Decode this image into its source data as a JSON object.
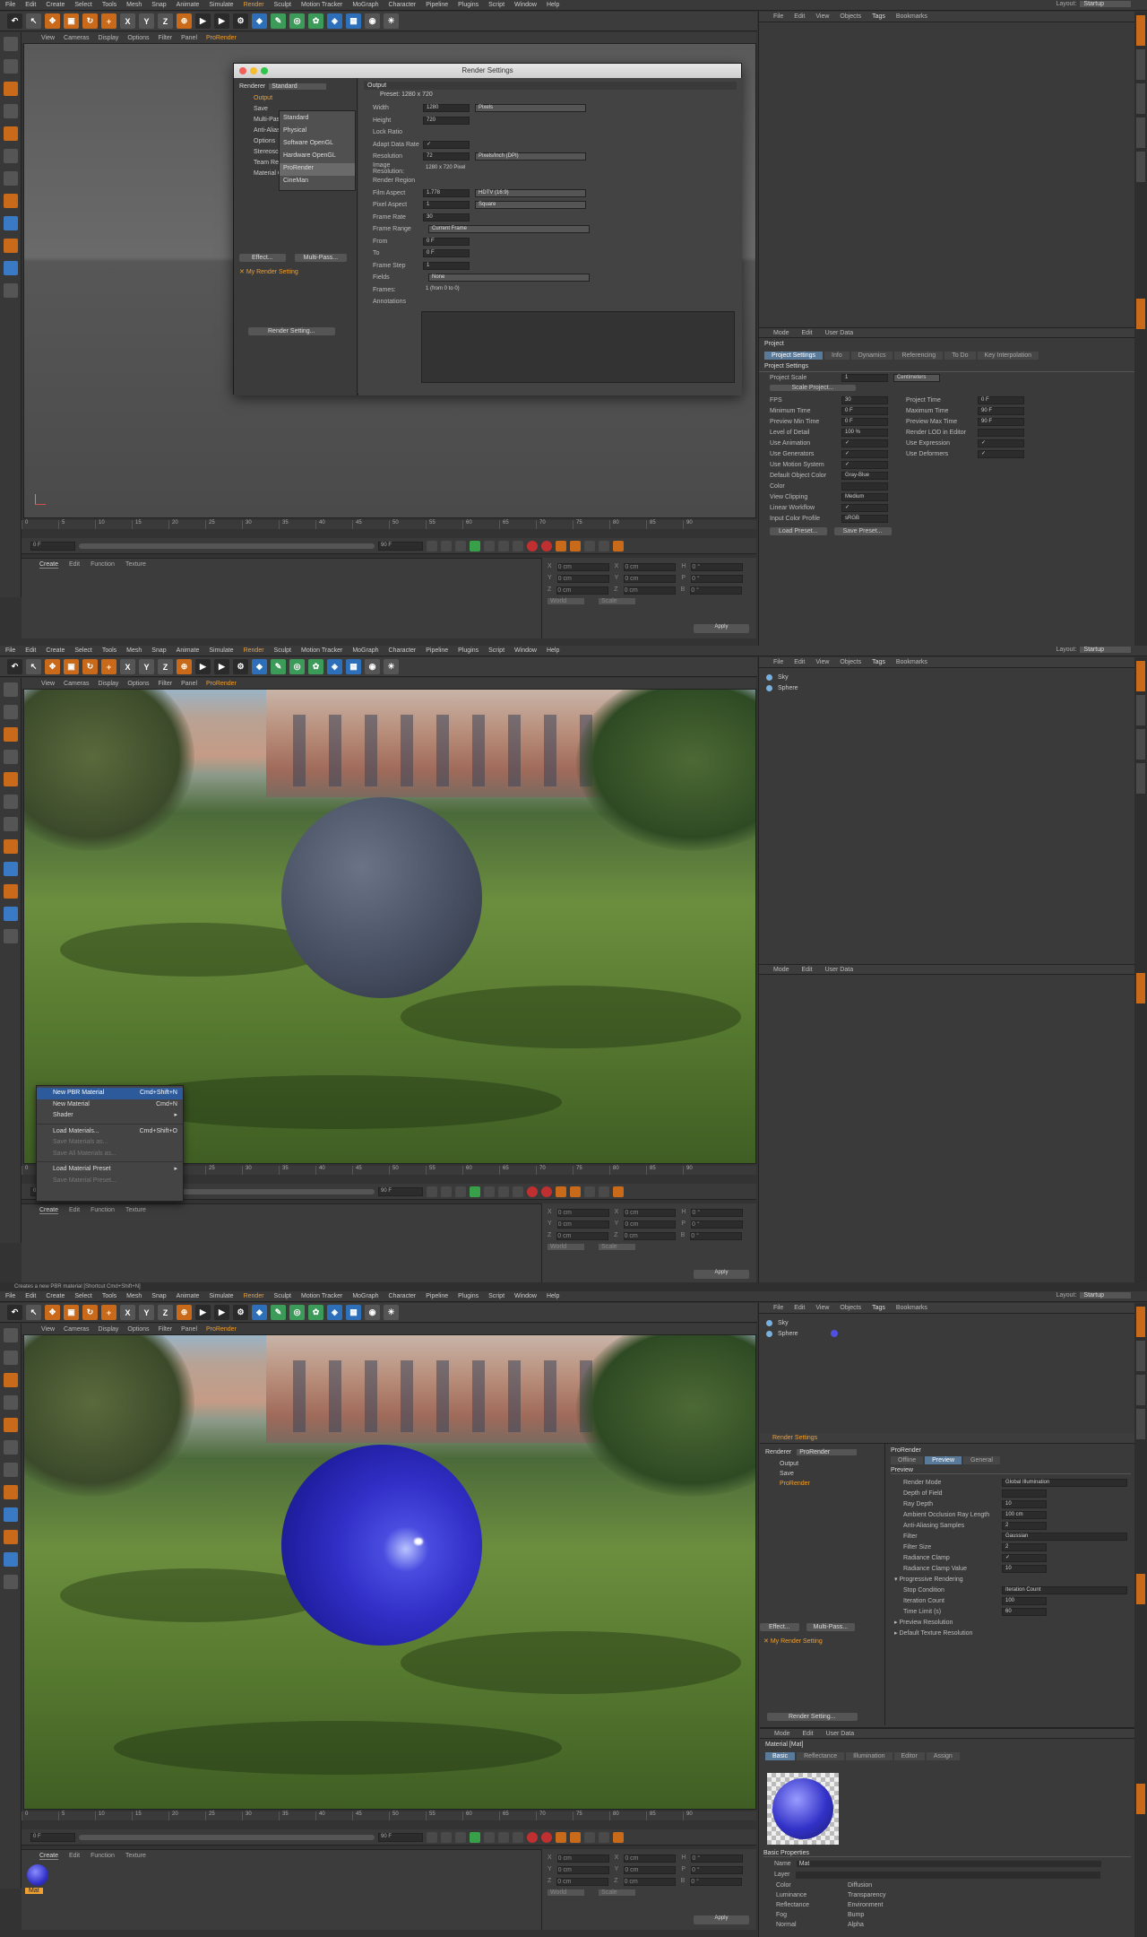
{
  "menu": [
    "File",
    "Edit",
    "Create",
    "Select",
    "Tools",
    "Mesh",
    "Snap",
    "Animate",
    "Simulate",
    "Render",
    "Sculpt",
    "Motion Tracker",
    "MoGraph",
    "Character",
    "Pipeline",
    "Plugins",
    "Script",
    "Window",
    "Help"
  ],
  "layout": {
    "label": "Layout:",
    "value": "Startup"
  },
  "viewport_menu": [
    "View",
    "Cameras",
    "Display",
    "Options",
    "Filter",
    "Panel",
    "ProRender"
  ],
  "timeline_ticks": [
    "0",
    "5",
    "10",
    "15",
    "20",
    "25",
    "30",
    "35",
    "40",
    "45",
    "50",
    "55",
    "60",
    "65",
    "70",
    "75",
    "80",
    "85",
    "90"
  ],
  "transport": {
    "start": "0 F",
    "end": "90 F",
    "current": "0 F"
  },
  "material_menu": [
    "Create",
    "Edit",
    "Function",
    "Texture"
  ],
  "coords": {
    "x": "X",
    "y": "Y",
    "z": "Z",
    "h": "H",
    "p": "P",
    "b": "B",
    "pos": "0 cm",
    "rot": "0 °",
    "world": "World",
    "scale": "Scale",
    "apply": "Apply"
  },
  "objman_menu": [
    "File",
    "Edit",
    "View",
    "Objects",
    "Tags",
    "Bookmarks"
  ],
  "attr_menu": [
    "Mode",
    "Edit",
    "User Data"
  ],
  "objects": [
    "Sky",
    "Sphere"
  ],
  "panel1": {
    "render_settings": {
      "title": "Render Settings",
      "renderer_label": "Renderer",
      "renderer_value": "Standard",
      "renderer_options": [
        "Standard",
        "Physical",
        "Software OpenGL",
        "Hardware OpenGL",
        "ProRender",
        "CineMan"
      ],
      "left_items": [
        "Output",
        "Save",
        "Multi-Pass",
        "Anti-Aliasing",
        "Options",
        "Stereoscopic",
        "Team Render",
        "Material Override"
      ],
      "effect_btn": "Effect...",
      "multipass_btn": "Multi-Pass...",
      "my_setting": "My Render Setting",
      "render_setting_btn": "Render Setting...",
      "section": "Output",
      "preset": "Preset: 1280 x 720",
      "rows": [
        {
          "l": "Width",
          "v": "1280",
          "d": "Pixels"
        },
        {
          "l": "Height",
          "v": "720",
          "d": ""
        },
        {
          "l": "Lock Ratio",
          "v": "",
          "d": ""
        },
        {
          "l": "Adapt Data Rate",
          "v": "✓",
          "d": ""
        },
        {
          "l": "Resolution",
          "v": "72",
          "d": "Pixels/Inch (DPI)"
        },
        {
          "l": "Image Resolution:",
          "v": "1280 x 720 Pixel",
          "d": ""
        },
        {
          "l": "Render Region",
          "v": "",
          "d": ""
        },
        {
          "l": "Film Aspect",
          "v": "1.778",
          "d": "HDTV (16:9)"
        },
        {
          "l": "Pixel Aspect",
          "v": "1",
          "d": "Square"
        },
        {
          "l": "Frame Rate",
          "v": "30",
          "d": ""
        },
        {
          "l": "Frame Range",
          "v": "",
          "d": "Current Frame"
        },
        {
          "l": "From",
          "v": "0 F",
          "d": ""
        },
        {
          "l": "To",
          "v": "0 F",
          "d": ""
        },
        {
          "l": "Frame Step",
          "v": "1",
          "d": ""
        },
        {
          "l": "Fields",
          "v": "",
          "d": "None"
        },
        {
          "l": "Frames:",
          "v": "1 (from 0 to 0)",
          "d": ""
        },
        {
          "l": "Annotations",
          "v": "",
          "d": ""
        }
      ]
    },
    "project": {
      "title": "Project",
      "tabs": [
        "Project Settings",
        "Info",
        "Dynamics",
        "Referencing",
        "To Do",
        "Key Interpolation"
      ],
      "section": "Project Settings",
      "scale_label": "Project Scale",
      "scale_value": "1",
      "scale_unit": "Centimeters",
      "scale_btn": "Scale Project...",
      "rows": [
        {
          "l": "FPS",
          "v": "30",
          "l2": "Project Time",
          "v2": "0 F"
        },
        {
          "l": "Minimum Time",
          "v": "0 F",
          "l2": "Maximum Time",
          "v2": "90 F"
        },
        {
          "l": "Preview Min Time",
          "v": "0 F",
          "l2": "Preview Max Time",
          "v2": "90 F"
        },
        {
          "l": "Level of Detail",
          "v": "100 %",
          "l2": "Render LOD in Editor",
          "v2": ""
        },
        {
          "l": "Use Animation",
          "v": "✓",
          "l2": "Use Expression",
          "v2": "✓"
        },
        {
          "l": "Use Generators",
          "v": "✓",
          "l2": "Use Deformers",
          "v2": "✓"
        },
        {
          "l": "Use Motion System",
          "v": "✓",
          "l2": "",
          "v2": ""
        },
        {
          "l": "Default Object Color",
          "v": "Gray-Blue",
          "l2": "",
          "v2": ""
        },
        {
          "l": "Color",
          "v": "",
          "l2": "",
          "v2": ""
        },
        {
          "l": "View Clipping",
          "v": "Medium",
          "l2": "",
          "v2": ""
        },
        {
          "l": "Linear Workflow",
          "v": "✓",
          "l2": "",
          "v2": ""
        },
        {
          "l": "Input Color Profile",
          "v": "sRGB",
          "l2": "",
          "v2": ""
        }
      ],
      "load_btn": "Load Preset...",
      "save_btn": "Save Preset..."
    }
  },
  "panel2": {
    "context_menu": [
      {
        "l": "New PBR Material",
        "k": "Cmd+Shift+N",
        "s": "on"
      },
      {
        "l": "New Material",
        "k": "Cmd+N",
        "s": ""
      },
      {
        "l": "Shader",
        "k": "▸",
        "s": ""
      },
      {
        "l": "Load Materials...",
        "k": "Cmd+Shift+O",
        "s": ""
      },
      {
        "l": "Save Materials as...",
        "k": "",
        "s": "dis"
      },
      {
        "l": "Save All Materials as...",
        "k": "",
        "s": "dis"
      },
      {
        "l": "Load Material Preset",
        "k": "▸",
        "s": ""
      },
      {
        "l": "Save Material Preset...",
        "k": "",
        "s": "dis"
      }
    ],
    "status": "Creates a new PBR material [Shortcut Cmd+Shift+N]"
  },
  "panel3": {
    "rs_title": "Render Settings",
    "renderer_label": "Renderer",
    "renderer_value": "ProRender",
    "left_items": [
      "Output",
      "Save",
      "ProRender"
    ],
    "section": "ProRender",
    "tabs": [
      "Offline",
      "Preview",
      "General"
    ],
    "sub": "Preview",
    "rows": [
      {
        "l": "Render Mode",
        "v": "Global Illumination"
      },
      {
        "l": "Depth of Field",
        "v": ""
      },
      {
        "l": "Ray Depth",
        "v": "10"
      },
      {
        "l": "Ambient Occlusion Ray Length",
        "v": "100 cm"
      },
      {
        "l": "Anti-Aliasing Samples",
        "v": "2"
      },
      {
        "l": "Filter",
        "v": "Gaussian"
      },
      {
        "l": "Filter Size",
        "v": "2"
      },
      {
        "l": "Radiance Clamp",
        "v": "✓"
      },
      {
        "l": "Radiance Clamp Value",
        "v": "10"
      },
      {
        "l": "▾ Progressive Rendering",
        "v": ""
      },
      {
        "l": "Stop Condition",
        "v": "Iteration Count"
      },
      {
        "l": "Iteration Count",
        "v": "100"
      },
      {
        "l": "Time Limit (s)",
        "v": "60"
      },
      {
        "l": "▸ Preview Resolution",
        "v": ""
      },
      {
        "l": "▸ Default Texture Resolution",
        "v": ""
      }
    ],
    "effect_btn": "Effect...",
    "multipass_btn": "Multi-Pass...",
    "my_setting": "My Render Setting",
    "render_setting_btn": "Render Setting...",
    "material": {
      "title": "Material [Mat]",
      "tabs": [
        "Basic",
        "Reflectance",
        "Illumination",
        "Editor",
        "Assign"
      ],
      "section": "Basic Properties",
      "name_label": "Name",
      "name_value": "Mat",
      "layer_label": "Layer",
      "channels": [
        "Color",
        "Luminance",
        "Reflectance",
        "Fog",
        "Normal"
      ],
      "channels2": [
        "Diffusion",
        "Transparency",
        "Environment",
        "Bump",
        "Alpha"
      ],
      "thumb_label": "Mat"
    }
  },
  "colors": {
    "accent": "#f0a030",
    "sphere_blue": "#3230c8",
    "sphere_grey": "#4a5366"
  }
}
